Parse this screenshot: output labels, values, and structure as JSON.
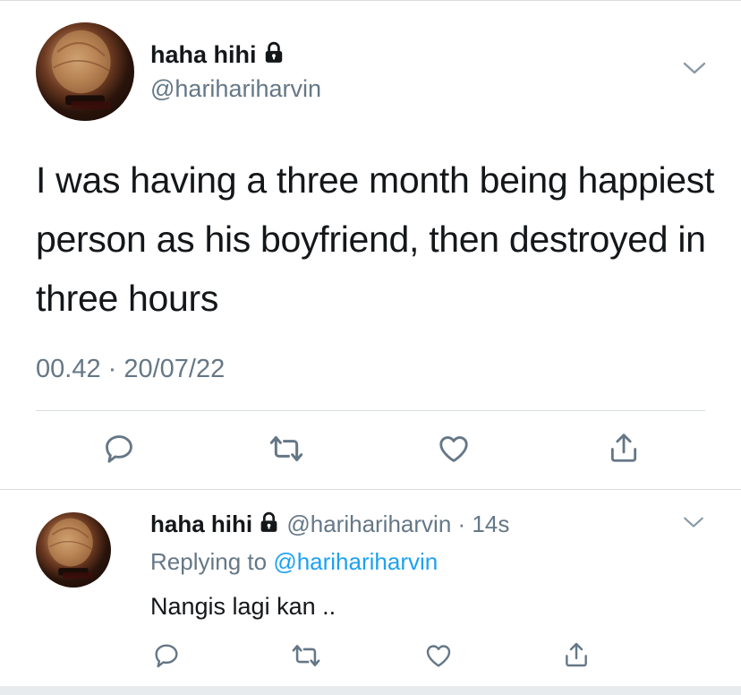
{
  "main_tweet": {
    "display_name": "haha hihi",
    "handle": "@harihariharvin",
    "text": "I was having a three month being happiest person as his boyfriend, then destroyed in three hours",
    "timestamp": "00.42 · 20/07/22",
    "protected_icon": "lock-icon",
    "actions": [
      "reply-icon",
      "retweet-icon",
      "like-icon",
      "share-icon"
    ]
  },
  "reply_tweet": {
    "display_name": "haha hihi",
    "handle": "@harihariharvin",
    "time_sep": "·",
    "time": "14s",
    "replying_label": "Replying to",
    "replying_to": "@harihariharvin",
    "text": "Nangis lagi kan ..",
    "protected_icon": "lock-icon",
    "actions": [
      "reply-icon",
      "retweet-icon",
      "like-icon",
      "share-icon"
    ]
  },
  "colors": {
    "text_primary": "#14171a",
    "text_secondary": "#657786",
    "link": "#1da1f2",
    "divider": "#d9dde0"
  }
}
